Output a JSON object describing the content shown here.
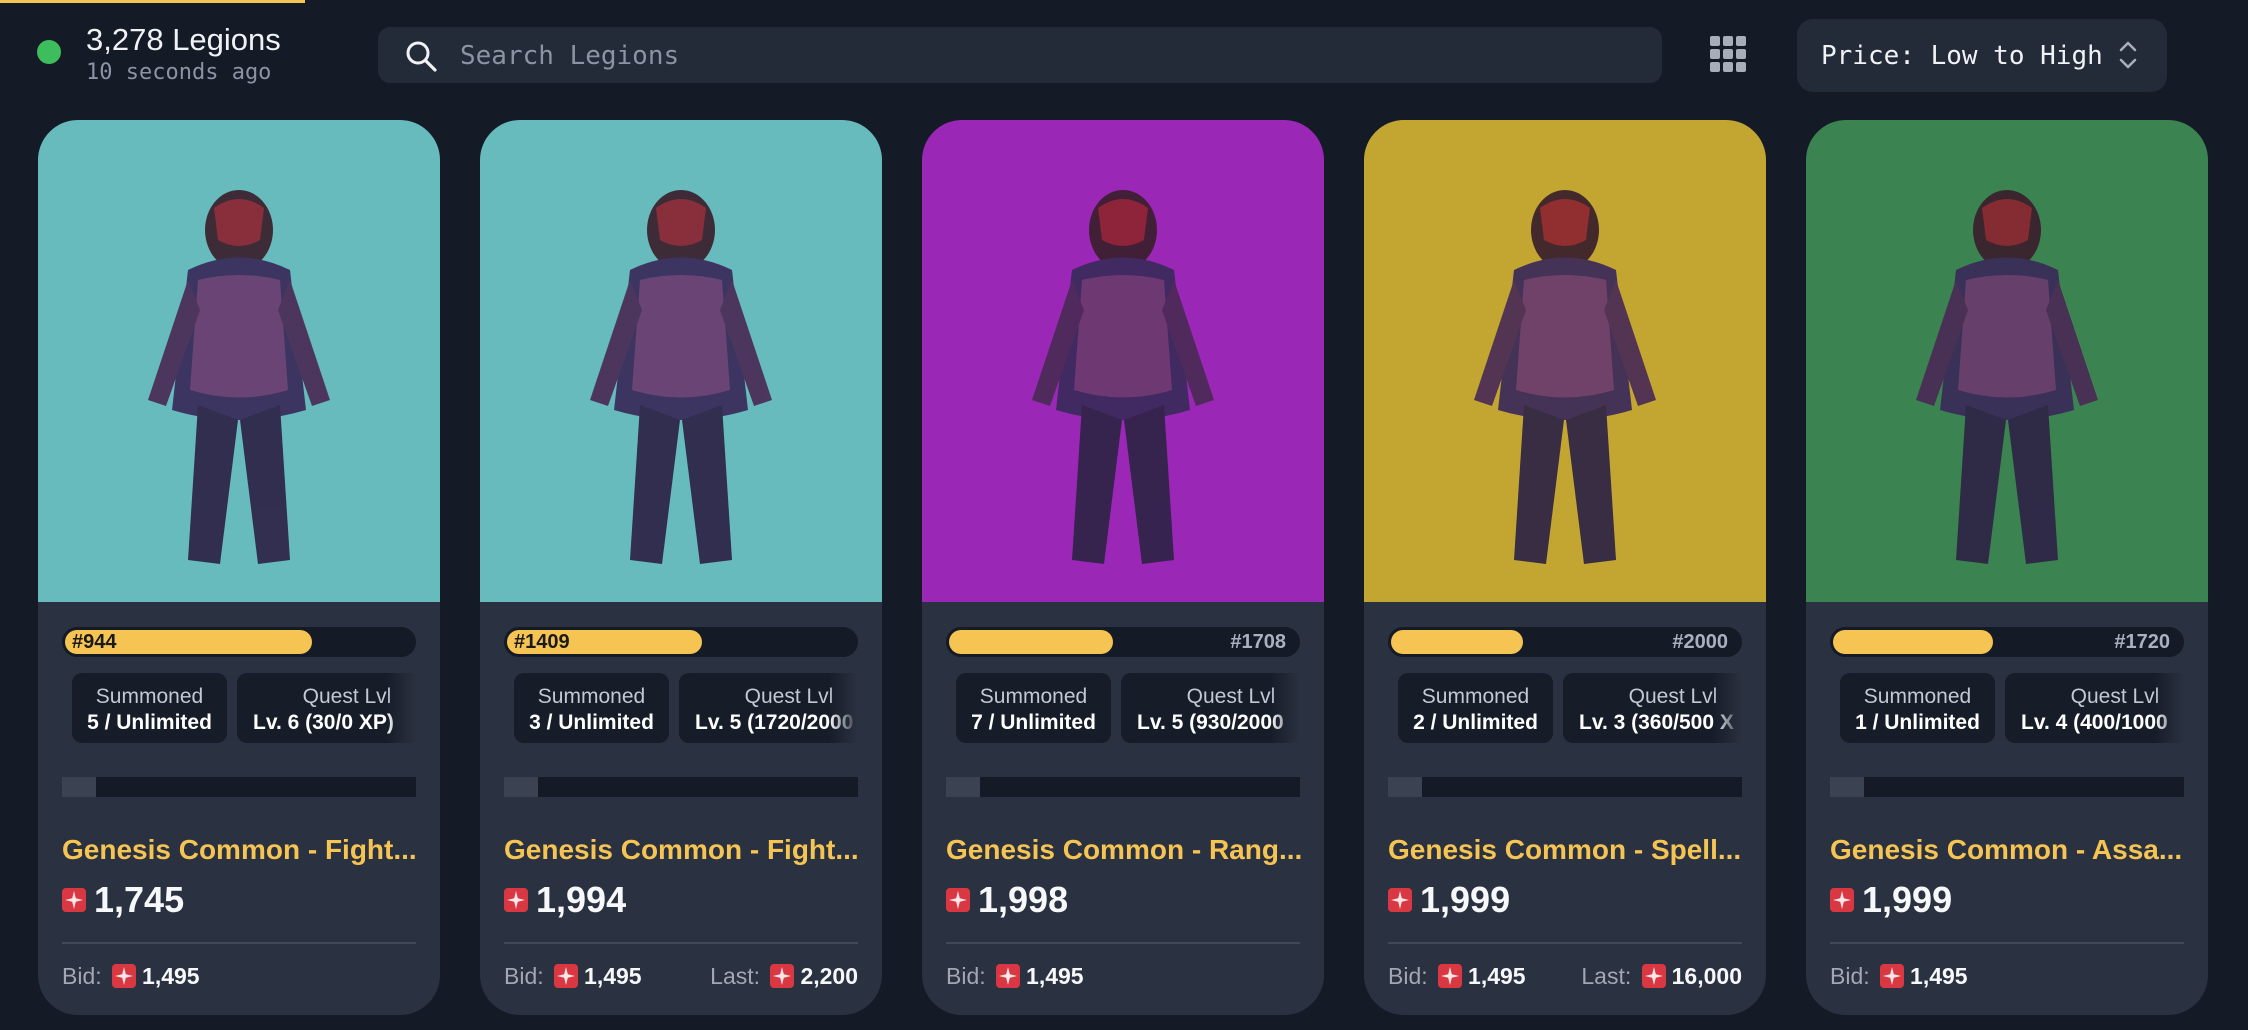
{
  "header": {
    "legion_count": "3,278 Legions",
    "updated": "10 seconds ago",
    "search_placeholder": "Search Legions",
    "sort_label": "Price: Low to High"
  },
  "colors": {
    "accent": "#f6c453",
    "background": "#141a26",
    "card": "#2a3140",
    "status_online": "#3ebd5c",
    "magic": "#d93742"
  },
  "cards": [
    {
      "rank_id": "#944",
      "rank_fraction": 0.71,
      "art_bg": "#67bbbd",
      "summoned_label": "Summoned",
      "summoned_value": "5 / Unlimited",
      "quest_label": "Quest Lvl",
      "quest_value": "Lv. 6 (30/0 XP)",
      "name": "Genesis Common - Fight...",
      "price": "1,745",
      "bid_label": "Bid:",
      "bid": "1,495"
    },
    {
      "rank_id": "#1409",
      "rank_fraction": 0.56,
      "art_bg": "#67bbbd",
      "summoned_label": "Summoned",
      "summoned_value": "3 / Unlimited",
      "quest_label": "Quest Lvl",
      "quest_value": "Lv. 5 (1720/2000",
      "name": "Genesis Common - Fight...",
      "price": "1,994",
      "bid_label": "Bid:",
      "bid": "1,495",
      "last_label": "Last:",
      "last": "2,200"
    },
    {
      "rank_id": "#1708",
      "rank_fraction": 0.47,
      "art_bg": "#9a27b6",
      "summoned_label": "Summoned",
      "summoned_value": "7 / Unlimited",
      "quest_label": "Quest Lvl",
      "quest_value": "Lv. 5 (930/2000",
      "name": "Genesis Common - Rang...",
      "price": "1,998",
      "bid_label": "Bid:",
      "bid": "1,495"
    },
    {
      "rank_id": "#2000",
      "rank_fraction": 0.38,
      "art_bg": "#c3a632",
      "summoned_label": "Summoned",
      "summoned_value": "2 / Unlimited",
      "quest_label": "Quest Lvl",
      "quest_value": "Lv. 3 (360/500 X",
      "name": "Genesis Common - Spell...",
      "price": "1,999",
      "bid_label": "Bid:",
      "bid": "1,495",
      "last_label": "Last:",
      "last": "16,000"
    },
    {
      "rank_id": "#1720",
      "rank_fraction": 0.46,
      "art_bg": "#3b8451",
      "summoned_label": "Summoned",
      "summoned_value": "1 / Unlimited",
      "quest_label": "Quest Lvl",
      "quest_value": "Lv. 4 (400/1000",
      "name": "Genesis Common - Assa...",
      "price": "1,999",
      "bid_label": "Bid:",
      "bid": "1,495"
    }
  ]
}
